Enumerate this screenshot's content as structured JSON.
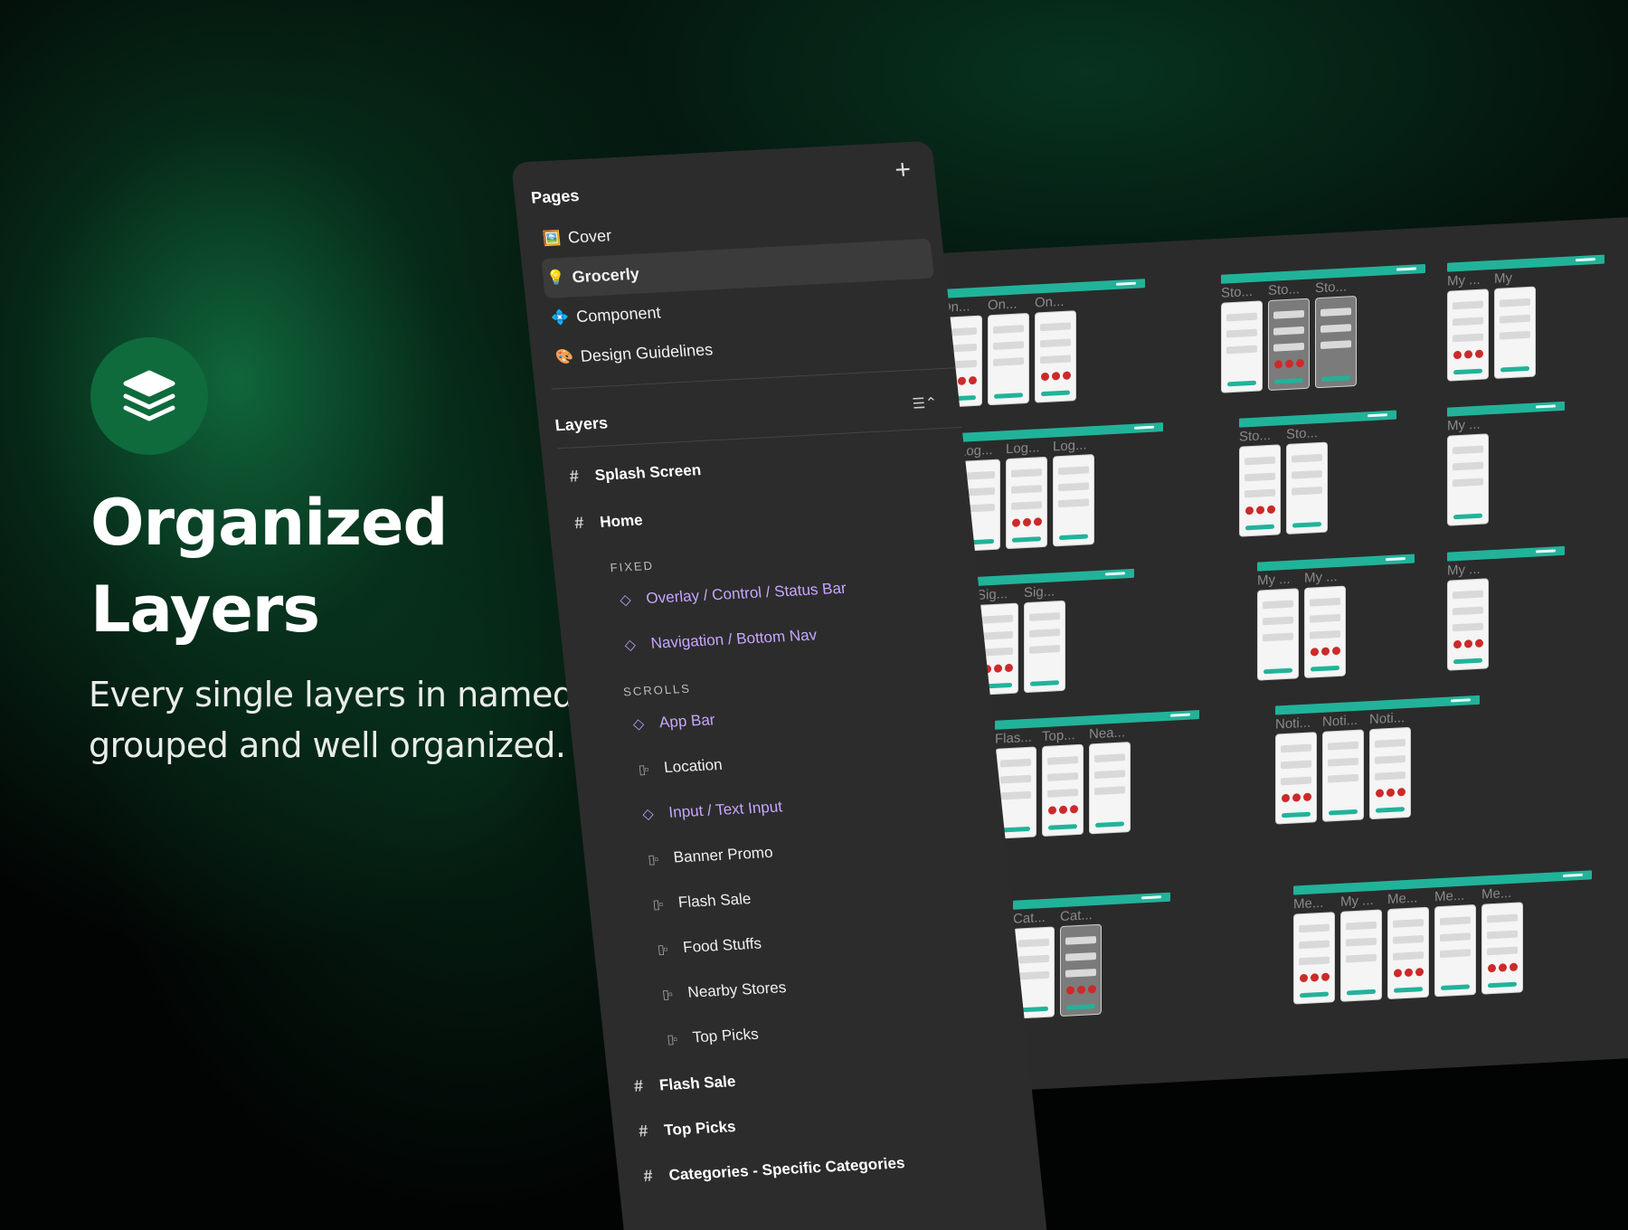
{
  "hero": {
    "icon": "stacked-layers-icon",
    "title_line1": "Organized",
    "title_line2": "Layers",
    "subtitle_line1": "Every single layers in named,",
    "subtitle_line2": "grouped and well organized."
  },
  "panel": {
    "pages_title": "Pages",
    "add_icon": "plus-icon",
    "pages": [
      {
        "icon": "🖼️",
        "label": "Cover"
      },
      {
        "icon": "💡",
        "label": "Grocerly"
      },
      {
        "icon": "💠",
        "label": "Component"
      },
      {
        "icon": "🎨",
        "label": "Design Guidelines"
      }
    ],
    "layers_title": "Layers",
    "collapse_icon": "collapse-layers-icon",
    "layers": {
      "splash": "Splash Screen",
      "home": "Home",
      "fixed": "FIXED",
      "status_bar": "Overlay / Control / Status Bar",
      "bottom_nav": "Navigation / Bottom Nav",
      "scrolls": "SCROLLS",
      "app_bar": "App Bar",
      "location": "Location",
      "text_input": "Input / Text Input",
      "banner_promo": "Banner Promo",
      "flash_sale_group": "Flash Sale",
      "food_stuffs": "Food Stuffs",
      "nearby_stores": "Nearby Stores",
      "top_picks_group": "Top Picks",
      "flash_sale_frame": "Flash Sale",
      "top_picks_frame": "Top Picks",
      "categories_frame": "Categories - Specific Categories"
    }
  },
  "canvas": {
    "accent": "#21b39a",
    "groups": [
      {
        "labels": [
          "On...",
          "On...",
          "On..."
        ]
      },
      {
        "labels": [
          "Sto...",
          "Sto...",
          "Sto..."
        ]
      },
      {
        "labels": [
          "My ...",
          "My"
        ]
      },
      {
        "labels": [
          "Log...",
          "Log...",
          "Log..."
        ]
      },
      {
        "labels": [
          "Sto...",
          "Sto..."
        ]
      },
      {
        "labels": [
          "My ..."
        ]
      },
      {
        "labels": [
          "Sig...",
          "Sig..."
        ]
      },
      {
        "labels": [
          "My ...",
          "My ..."
        ]
      },
      {
        "labels": [
          "My ..."
        ]
      },
      {
        "labels": [
          "Flas...",
          "Top...",
          "Nea..."
        ]
      },
      {
        "labels": [
          "Noti...",
          "Noti...",
          "Noti..."
        ]
      },
      {
        "labels": [
          "Cat...",
          "Cat..."
        ]
      },
      {
        "labels": [
          "Me...",
          "My ...",
          "Me...",
          "Me...",
          "Me..."
        ]
      }
    ]
  }
}
